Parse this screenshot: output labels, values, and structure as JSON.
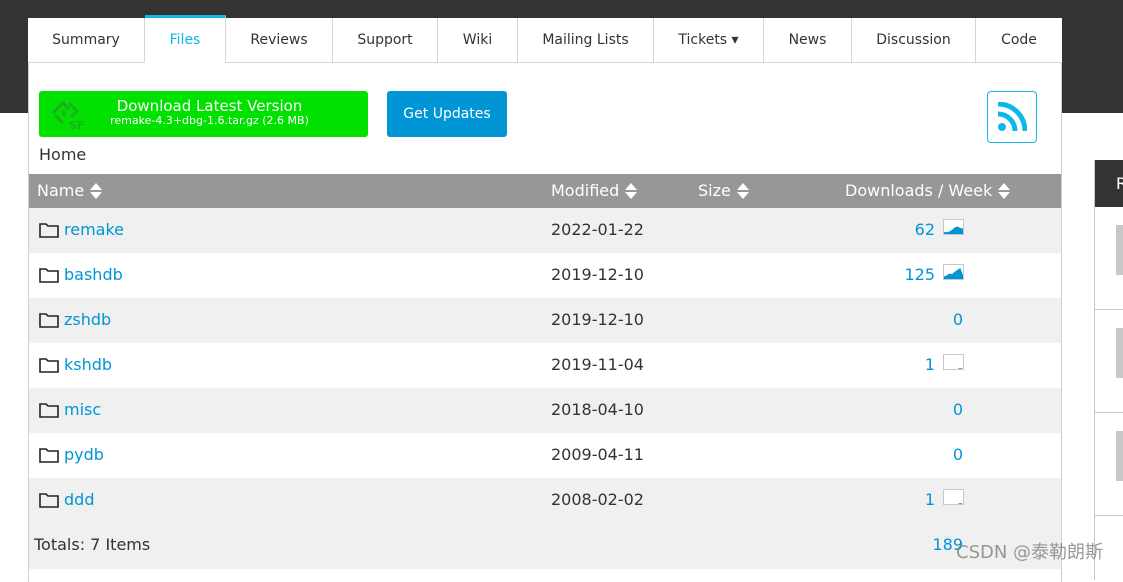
{
  "tabs": [
    {
      "label": "Summary",
      "active": false
    },
    {
      "label": "Files",
      "active": true
    },
    {
      "label": "Reviews",
      "active": false
    },
    {
      "label": "Support",
      "active": false
    },
    {
      "label": "Wiki",
      "active": false
    },
    {
      "label": "Mailing Lists",
      "active": false
    },
    {
      "label": "Tickets ▾",
      "active": false
    },
    {
      "label": "News",
      "active": false
    },
    {
      "label": "Discussion",
      "active": false
    },
    {
      "label": "Code",
      "active": false
    }
  ],
  "download": {
    "title": "Download Latest Version",
    "file": "remake-4.3+dbg-1.6.tar.gz (2.6 MB)",
    "logo_icon": "sourceforge-logo-icon",
    "color": "#00e100"
  },
  "get_updates_label": "Get Updates",
  "rss_icon": "rss-icon",
  "breadcrumb": "Home",
  "table": {
    "columns": [
      "Name",
      "Modified",
      "Size",
      "Downloads / Week"
    ],
    "rows": [
      {
        "name": "remake",
        "modified": "2022-01-22",
        "size": "",
        "downloads": "62",
        "sparkline": [
          0.15,
          0.15,
          0.2,
          0.35,
          0.55,
          0.6,
          0.5,
          0.45
        ],
        "has_spark": true
      },
      {
        "name": "bashdb",
        "modified": "2019-12-10",
        "size": "",
        "downloads": "125",
        "sparkline": [
          0.2,
          0.3,
          0.45,
          0.4,
          0.6,
          0.75,
          0.9,
          0.3
        ],
        "has_spark": true
      },
      {
        "name": "zshdb",
        "modified": "2019-12-10",
        "size": "",
        "downloads": "0",
        "has_spark": false
      },
      {
        "name": "kshdb",
        "modified": "2019-11-04",
        "size": "",
        "downloads": "1",
        "sparkline": [
          0,
          0,
          0,
          0,
          0,
          0,
          0.08,
          0
        ],
        "has_spark": true
      },
      {
        "name": "misc",
        "modified": "2018-04-10",
        "size": "",
        "downloads": "0",
        "has_spark": false
      },
      {
        "name": "pydb",
        "modified": "2009-04-11",
        "size": "",
        "downloads": "0",
        "has_spark": false
      },
      {
        "name": "ddd",
        "modified": "2008-02-02",
        "size": "",
        "downloads": "1",
        "sparkline": [
          0,
          0,
          0,
          0,
          0,
          0,
          0.08,
          0
        ],
        "has_spark": true
      }
    ],
    "totals_label": "Totals: 7 Items",
    "totals_downloads": "189"
  },
  "sidebar": {
    "header_initial": "R"
  },
  "watermark": "CSDN @泰勒朗斯",
  "colors": {
    "accent": "#0db8e9",
    "link": "#0095d5",
    "header_bg": "#979797",
    "dark": "#333333"
  }
}
